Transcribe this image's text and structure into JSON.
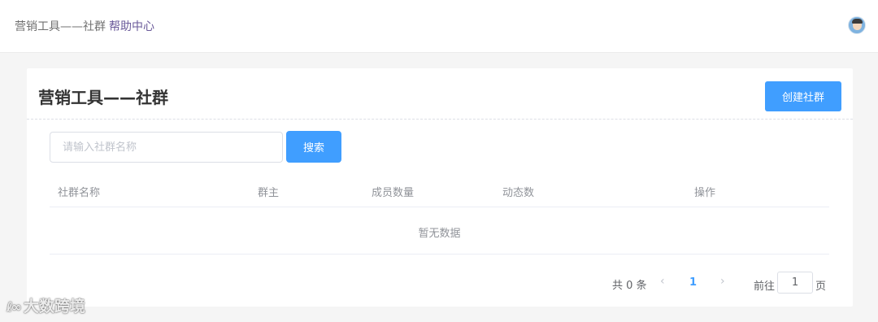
{
  "header": {
    "breadcrumb": "营销工具——社群",
    "help_link": "帮助中心"
  },
  "page": {
    "title": "营销工具——社群",
    "create_button": "创建社群"
  },
  "search": {
    "placeholder": "请输入社群名称",
    "value": "",
    "button": "搜索"
  },
  "table": {
    "columns": [
      "社群名称",
      "群主",
      "成员数量",
      "动态数",
      "操作"
    ],
    "rows": [],
    "empty_text": "暂无数据"
  },
  "pagination": {
    "total_text": "共 0 条",
    "prev_icon": "chevron-left-icon",
    "current_page": "1",
    "next_icon": "chevron-right-icon",
    "goto_label": "前往",
    "goto_value": "1",
    "goto_suffix": "页"
  },
  "watermark": {
    "logo": "ℓ∞",
    "text": "大数跨境"
  },
  "colors": {
    "primary": "#409eff",
    "help_link": "#6a5a9a",
    "background": "#f5f5f5"
  }
}
